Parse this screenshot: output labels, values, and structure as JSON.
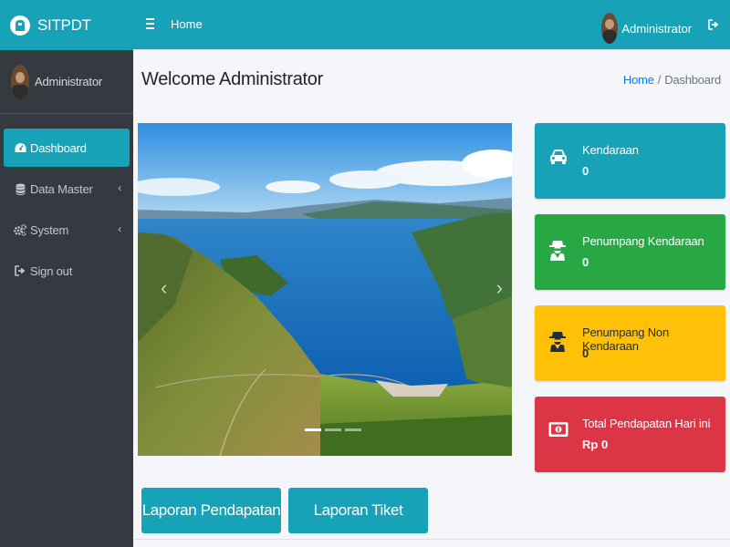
{
  "brand": {
    "name": "SITPDT"
  },
  "sidebar": {
    "user": "Administrator",
    "items": [
      {
        "label": "Dashboard",
        "icon": "dashboard-icon",
        "active": true
      },
      {
        "label": "Data Master",
        "icon": "database-icon",
        "has_children": true
      },
      {
        "label": "System",
        "icon": "gears-icon",
        "has_children": true
      },
      {
        "label": "Sign out",
        "icon": "sign-out-icon"
      }
    ]
  },
  "topbar": {
    "home_label": "Home",
    "user": "Administrator"
  },
  "content": {
    "title": "Welcome Administrator",
    "breadcrumb": {
      "home": "Home",
      "separator": "/",
      "current": "Dashboard"
    }
  },
  "info_boxes": [
    {
      "label": "Kendaraan",
      "value": "0",
      "icon": "car-icon",
      "color": "#17a2b8"
    },
    {
      "label": "Penumpang Kendaraan",
      "value": "0",
      "icon": "user-secret-icon",
      "color": "#28a745"
    },
    {
      "label": "Penumpang Non Kendaraan",
      "value": "0",
      "icon": "user-secret-icon",
      "color": "#ffc107"
    },
    {
      "label": "Total Pendapatan Hari ini",
      "value": "Rp 0",
      "icon": "money-icon",
      "color": "#dc3545"
    }
  ],
  "buttons": {
    "pendapatan": "Laporan Pendapatan",
    "tiket": "Laporan Tiket"
  },
  "colors": {
    "accent": "#17a2b8",
    "sidebar": "#343a40",
    "success": "#28a745",
    "warning": "#ffc107",
    "danger": "#dc3545"
  }
}
